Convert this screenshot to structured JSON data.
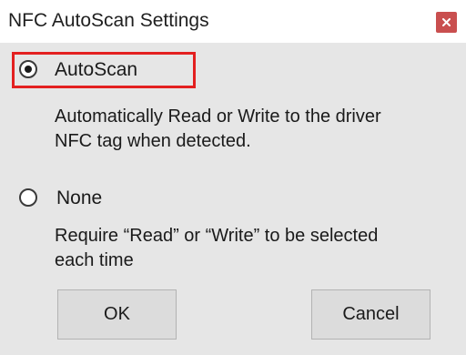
{
  "window": {
    "title": "NFC AutoScan Settings",
    "close_icon": "close-icon"
  },
  "options": [
    {
      "label": "AutoScan",
      "selected": true,
      "description_lines": [
        "Automatically Read or Write to the driver",
        "NFC tag when detected."
      ]
    },
    {
      "label": "None",
      "selected": false,
      "description_lines": [
        "Require “Read” or “Write” to be selected",
        "each time"
      ]
    }
  ],
  "buttons": {
    "ok_label": "OK",
    "cancel_label": "Cancel"
  },
  "colors": {
    "highlight": "#e32020",
    "close_button": "#c94f4f",
    "dialog_background": "#e6e6e6"
  }
}
